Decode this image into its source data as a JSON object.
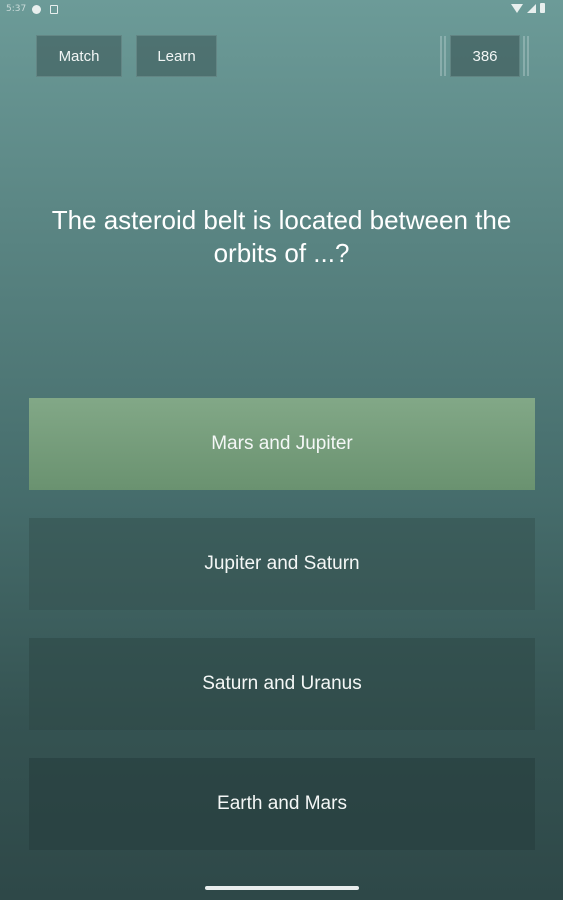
{
  "status_bar": {
    "time": "5:37",
    "icons": [
      "shield-icon",
      "notification-icon",
      "wifi-icon",
      "signal-icon",
      "battery-icon"
    ]
  },
  "header": {
    "match_label": "Match",
    "learn_label": "Learn",
    "score": "386"
  },
  "question": {
    "text": "The asteroid belt is located between the orbits of ...?"
  },
  "answers": [
    {
      "label": "Mars and Jupiter",
      "state": "correct"
    },
    {
      "label": "Jupiter and Saturn",
      "state": "default"
    },
    {
      "label": "Saturn and Uranus",
      "state": "default"
    },
    {
      "label": "Earth and Mars",
      "state": "default"
    }
  ],
  "colors": {
    "background_top": "#6c9b98",
    "background_bottom": "#2e4848",
    "correct_answer": "#78a07c",
    "text": "#ffffff"
  }
}
